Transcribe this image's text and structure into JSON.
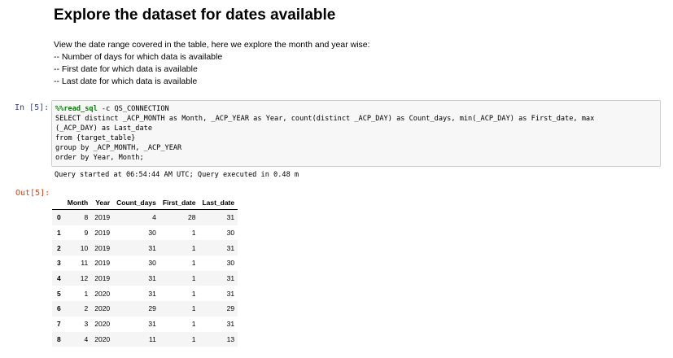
{
  "markdown": {
    "title": "Explore the dataset for dates available",
    "lines": [
      "View the date range covered in the table, here we explore the month and year wise:",
      "-- Number of days for which data is available",
      "-- First date for which data is available",
      "-- Last date for which data is available"
    ]
  },
  "code_cell": {
    "prompt": "In [5]:",
    "magic": "%%read_sql",
    "lines": [
      " -c QS_CONNECTION",
      "SELECT distinct _ACP_MONTH as Month, _ACP_YEAR as Year, count(distinct _ACP_DAY) as Count_days, min(_ACP_DAY) as First_date, max",
      "(_ACP_DAY) as Last_date",
      "from {target_table}",
      "group by _ACP_MONTH, _ACP_YEAR",
      "order by Year, Month;"
    ],
    "stdout": "Query started at 06:54:44 AM UTC; Query executed in 0.48 m"
  },
  "output": {
    "prompt": "Out[5]:",
    "columns": [
      "",
      "Month",
      "Year",
      "Count_days",
      "First_date",
      "Last_date"
    ],
    "rows": [
      [
        "0",
        "8",
        "2019",
        "4",
        "28",
        "31"
      ],
      [
        "1",
        "9",
        "2019",
        "30",
        "1",
        "30"
      ],
      [
        "2",
        "10",
        "2019",
        "31",
        "1",
        "31"
      ],
      [
        "3",
        "11",
        "2019",
        "30",
        "1",
        "30"
      ],
      [
        "4",
        "12",
        "2019",
        "31",
        "1",
        "31"
      ],
      [
        "5",
        "1",
        "2020",
        "31",
        "1",
        "31"
      ],
      [
        "6",
        "2",
        "2020",
        "29",
        "1",
        "29"
      ],
      [
        "7",
        "3",
        "2020",
        "31",
        "1",
        "31"
      ],
      [
        "8",
        "4",
        "2020",
        "11",
        "1",
        "13"
      ]
    ]
  }
}
